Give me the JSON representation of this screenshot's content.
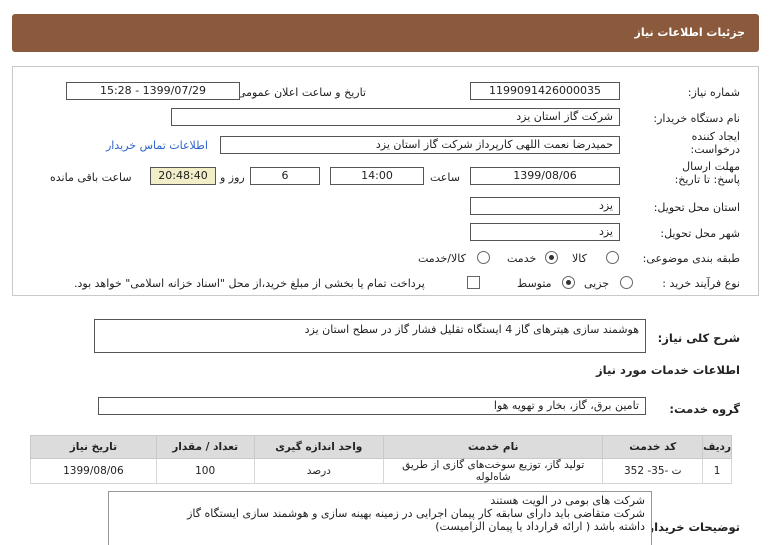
{
  "title": "جزئیات اطلاعات نیاز",
  "need_number": {
    "label": "شماره نیاز:",
    "value": "1199091426000035"
  },
  "announce_datetime": {
    "label": "تاریخ و ساعت اعلان عمومی:",
    "value": "1399/07/29 - 15:28"
  },
  "buyer": {
    "label": "نام دستگاه خریدار:",
    "value": "شرکت گاز استان یزد"
  },
  "creator": {
    "label": "ایجاد کننده درخواست:",
    "value": "حمیدرضا نعمت اللهی کارپرداز  شرکت گاز استان یزد",
    "contact_link": "اطلاعات تماس خریدار"
  },
  "deadline": {
    "label": "مهلت ارسال پاسخ: تا تاریخ:",
    "date": "1399/08/06",
    "time_label": "ساعت",
    "time": "14:00",
    "days": "6",
    "days_label": "روز و",
    "remaining": "20:48:40",
    "remaining_label": "ساعت باقی مانده"
  },
  "province": {
    "label": "استان محل تحویل:",
    "value": "یزد"
  },
  "city": {
    "label": "شهر محل تحویل:",
    "value": "یزد"
  },
  "category": {
    "label": "طبقه بندی موضوعی:",
    "options": [
      "کالا",
      "خدمت",
      "کالا/خدمت"
    ],
    "selected": "خدمت"
  },
  "process": {
    "label": "نوع فرآیند خرید :",
    "options": [
      "جزیی",
      "متوسط"
    ],
    "selected": "متوسط",
    "checkbox_text": "پرداخت تمام یا بخشی از مبلغ خرید،از محل \"اسناد خزانه اسلامی\" خواهد بود."
  },
  "summary": {
    "label": "شرح کلی نیاز:",
    "value": "هوشمند سازی هیترهای گاز 4 ایستگاه تقلیل فشار گاز در سطح استان یزد"
  },
  "services_info_header": "اطلاعات خدمات مورد نیاز",
  "service_group": {
    "label": "گروه خدمت:",
    "value": "تامین برق، گاز، بخار و تهویه هوا"
  },
  "table": {
    "headers": [
      "ردیف",
      "کد خدمت",
      "نام خدمت",
      "واحد اندازه گیری",
      "تعداد / مقدار",
      "تاریخ نیاز"
    ],
    "rows": [
      [
        "1",
        "ت -35- 352",
        "تولید گاز، توزیع سوخت‌های گازی از طریق شاه‌لوله",
        "درصد",
        "100",
        "1399/08/06"
      ]
    ]
  },
  "buyer_notes": {
    "label": "توضیحات خریدار:",
    "lines": [
      "شرکت های بومی در الویت هستند",
      "شرکت متقاضی باید دارای سابقه کار  پیمان اجرایی در زمینه بهینه سازی و هوشمند سازی ایستگاه گاز",
      "داشته باشد ( ارائه قرارداد یا پیمان الزامیست)"
    ]
  },
  "colors": {
    "titlebar": "#8b5a3c",
    "link": "#2b64c9",
    "remaining_bg": "#f2eec8",
    "table_header": "#dcdcdc"
  }
}
